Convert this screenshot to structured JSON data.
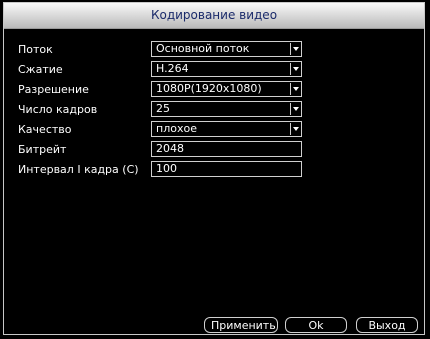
{
  "window": {
    "title": "Кодирование видео"
  },
  "form": {
    "stream": {
      "label": "Поток",
      "value": "Основной поток"
    },
    "compression": {
      "label": "Сжатие",
      "value": "H.264"
    },
    "resolution": {
      "label": "Разрешение",
      "value": "1080P(1920x1080)"
    },
    "frame_rate": {
      "label": "Число кадров",
      "value": "25"
    },
    "quality": {
      "label": "Качество",
      "value": "плохое"
    },
    "bitrate": {
      "label": "Битрейт",
      "value": "2048"
    },
    "i_frame_interval": {
      "label": "Интервал I кадра (С)",
      "value": "100"
    }
  },
  "buttons": {
    "apply": "Применить",
    "ok": "Ok",
    "exit": "Выход"
  },
  "colors": {
    "background": "#000000",
    "border": "#d0d0d0",
    "title_text": "#1a2a6a"
  }
}
